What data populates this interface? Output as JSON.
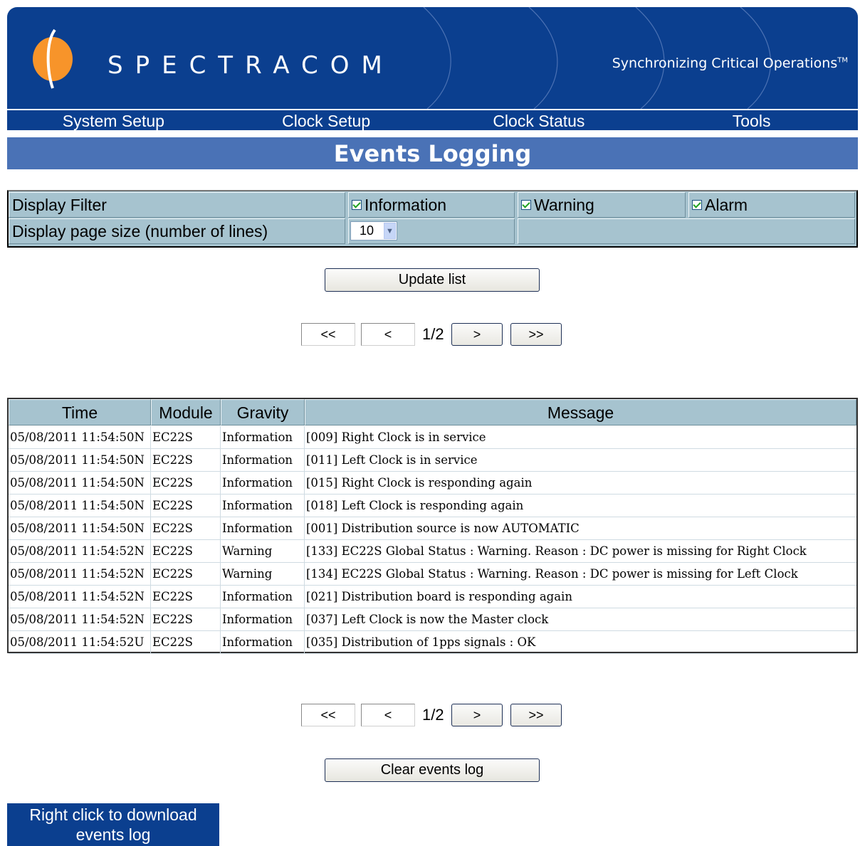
{
  "header": {
    "brand": "SPECTRACOM",
    "tagline": "Synchronizing Critical Operations",
    "tagline_mark": "TM",
    "colors": {
      "banner": "#0b3f8f",
      "logo": "#f7942a",
      "title_bar": "#4a72b6",
      "table_header": "#a6c3cf"
    }
  },
  "nav": {
    "items": [
      "System Setup",
      "Clock Setup",
      "Clock Status",
      "Tools"
    ]
  },
  "page_title": "Events Logging",
  "filter": {
    "label": "Display Filter",
    "information": "Information",
    "warning": "Warning",
    "alarm": "Alarm",
    "page_size_label": "Display page size (number of lines)",
    "page_size_value": "10"
  },
  "buttons": {
    "update": "Update list",
    "clear": "Clear events log",
    "download": "Right click to download events log"
  },
  "pager": {
    "first": "<<",
    "prev": "<",
    "count": "1/2",
    "next": ">",
    "last": ">>"
  },
  "events": {
    "headers": [
      "Time",
      "Module",
      "Gravity",
      "Message"
    ],
    "rows": [
      [
        "05/08/2011 11:54:50N",
        "EC22S",
        "Information",
        "[009] Right Clock is in service"
      ],
      [
        "05/08/2011 11:54:50N",
        "EC22S",
        "Information",
        "[011] Left Clock is in service"
      ],
      [
        "05/08/2011 11:54:50N",
        "EC22S",
        "Information",
        "[015] Right Clock is responding again"
      ],
      [
        "05/08/2011 11:54:50N",
        "EC22S",
        "Information",
        "[018] Left Clock is responding again"
      ],
      [
        "05/08/2011 11:54:50N",
        "EC22S",
        "Information",
        "[001] Distribution source is now AUTOMATIC"
      ],
      [
        "05/08/2011 11:54:52N",
        "EC22S",
        "Warning",
        "[133] EC22S Global Status : Warning. Reason : DC power is missing for Right Clock"
      ],
      [
        "05/08/2011 11:54:52N",
        "EC22S",
        "Warning",
        "[134] EC22S Global Status : Warning. Reason : DC power is missing for Left Clock"
      ],
      [
        "05/08/2011 11:54:52N",
        "EC22S",
        "Information",
        "[021] Distribution board is responding again"
      ],
      [
        "05/08/2011 11:54:52N",
        "EC22S",
        "Information",
        "[037] Left Clock is now the Master clock"
      ],
      [
        "05/08/2011 11:54:52U",
        "EC22S",
        "Information",
        "[035] Distribution of 1pps signals : OK"
      ]
    ]
  }
}
